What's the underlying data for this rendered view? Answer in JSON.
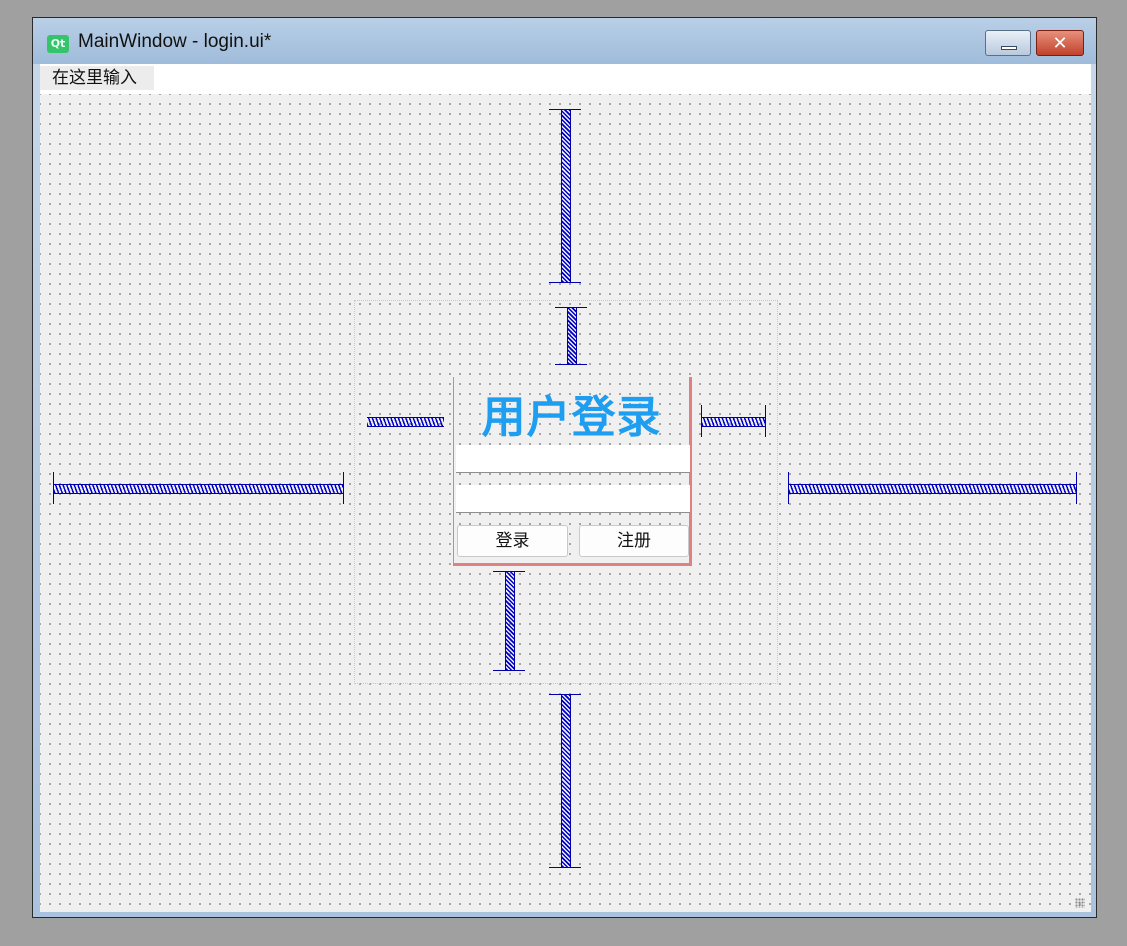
{
  "window": {
    "title": "MainWindow - login.ui*",
    "icon": "qt-icon",
    "icon_text": "Qt"
  },
  "menubar": {
    "items": [
      {
        "label": "在这里输入"
      }
    ]
  },
  "login": {
    "title": "用户登录",
    "username": {
      "value": "",
      "placeholder": ""
    },
    "password": {
      "value": "",
      "placeholder": ""
    },
    "login_button": "登录",
    "register_button": "注册"
  },
  "colors": {
    "title_text": "#1e9ef0",
    "spacer": "#0000cc",
    "selection_border": "#e08080"
  }
}
